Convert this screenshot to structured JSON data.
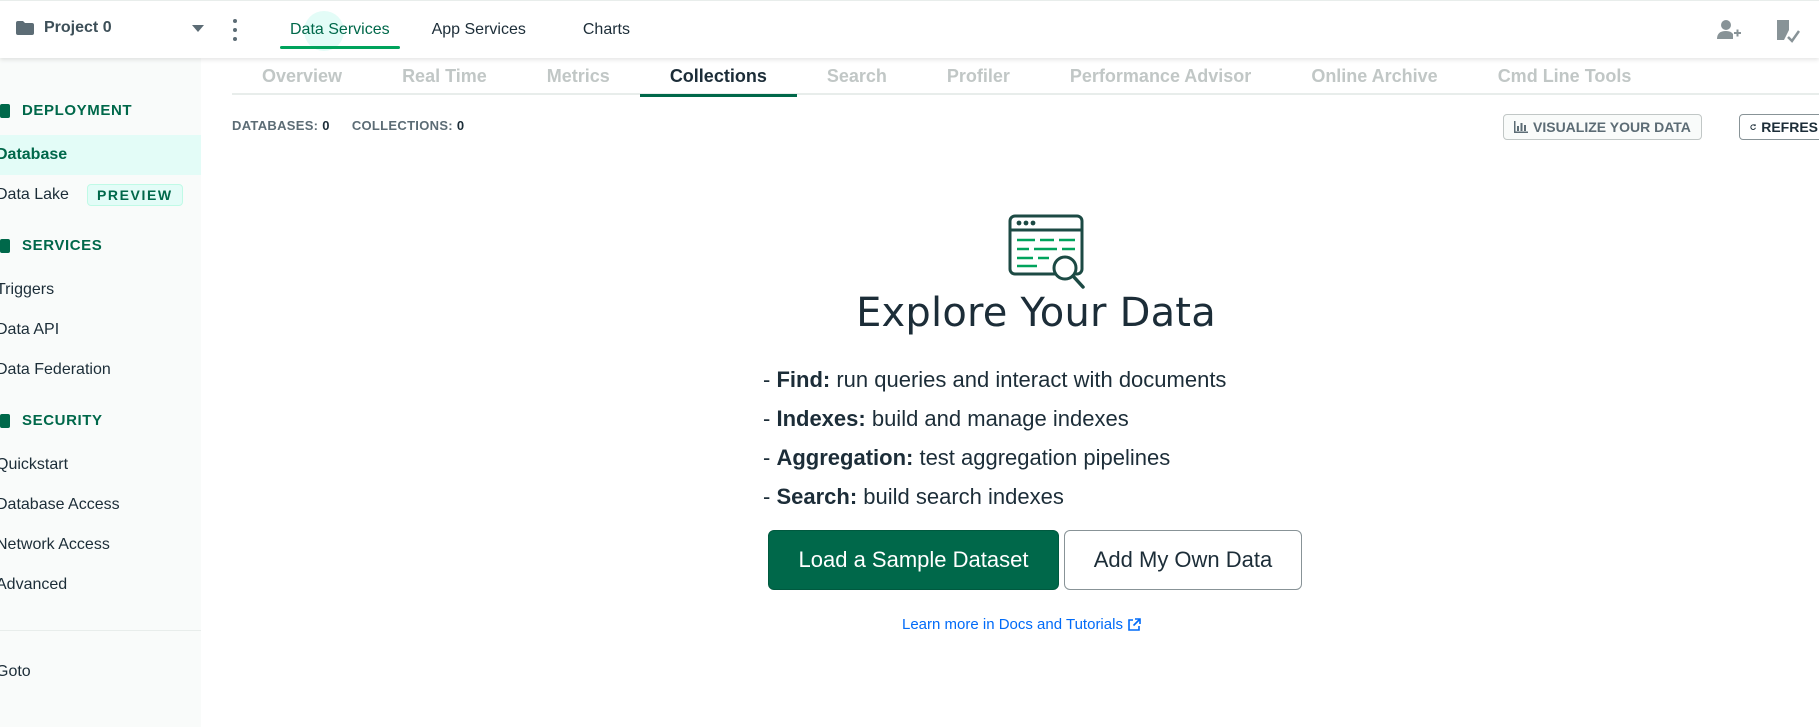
{
  "topbar": {
    "project_name": "Project 0",
    "tabs": [
      {
        "label": "Data Services",
        "active": true
      },
      {
        "label": "App Services",
        "active": false
      },
      {
        "label": "Charts",
        "active": false
      }
    ]
  },
  "sidebar": {
    "deployment": {
      "heading": "DEPLOYMENT",
      "items": [
        {
          "label": "Database",
          "active": true
        },
        {
          "label": "Data Lake",
          "badge": "PREVIEW"
        }
      ]
    },
    "services": {
      "heading": "SERVICES",
      "items": [
        {
          "label": "Triggers"
        },
        {
          "label": "Data API"
        },
        {
          "label": "Data Federation"
        }
      ]
    },
    "security": {
      "heading": "SECURITY",
      "items": [
        {
          "label": "Quickstart"
        },
        {
          "label": "Database Access"
        },
        {
          "label": "Network Access"
        },
        {
          "label": "Advanced"
        }
      ]
    },
    "goto": "Goto"
  },
  "subtabs": [
    {
      "label": "Overview"
    },
    {
      "label": "Real Time"
    },
    {
      "label": "Metrics"
    },
    {
      "label": "Collections",
      "active": true
    },
    {
      "label": "Search"
    },
    {
      "label": "Profiler"
    },
    {
      "label": "Performance Advisor"
    },
    {
      "label": "Online Archive"
    },
    {
      "label": "Cmd Line Tools"
    }
  ],
  "stats": {
    "databases_label": "DATABASES:",
    "databases_value": "0",
    "collections_label": "COLLECTIONS:",
    "collections_value": "0"
  },
  "actions": {
    "visualize": "VISUALIZE YOUR DATA",
    "refresh": "REFRES"
  },
  "empty_state": {
    "title": "Explore Your Data",
    "bullets": [
      {
        "term": "Find:",
        "text": " run queries and interact with documents"
      },
      {
        "term": "Indexes:",
        "text": " build and manage indexes"
      },
      {
        "term": "Aggregation:",
        "text": " test aggregation pipelines"
      },
      {
        "term": "Search:",
        "text": " build search indexes"
      }
    ],
    "primary_button": "Load a Sample Dataset",
    "secondary_button": "Add My Own Data",
    "learn_link": "Learn more in Docs and Tutorials"
  },
  "colors": {
    "brand_green": "#00684a",
    "accent_green": "#00a35c",
    "link_blue": "#016bf8",
    "sidebar_bg": "#f9fbfa"
  }
}
